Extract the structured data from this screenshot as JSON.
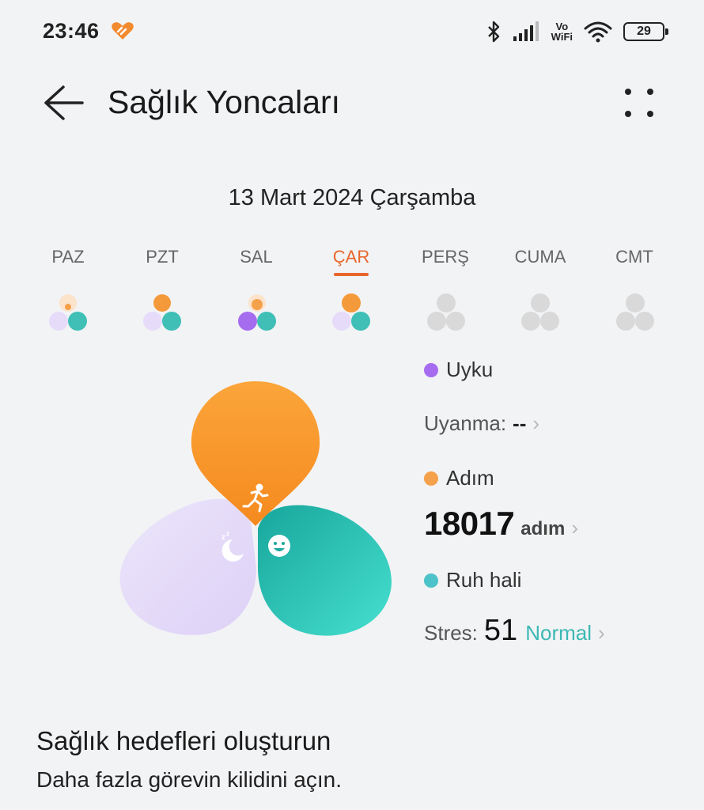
{
  "status_bar": {
    "time": "23:46",
    "vowifi_top": "Vo",
    "vowifi_bottom": "WiFi",
    "battery": "29",
    "icons": [
      "health-app-icon",
      "bluetooth-icon",
      "signal-icon",
      "vowifi-icon",
      "wifi-icon",
      "battery-icon"
    ]
  },
  "header": {
    "title": "Sağlık Yoncaları",
    "back_icon": "arrow-left-icon",
    "more_icon": "more-dots-icon"
  },
  "date": "13 Mart 2024 Çarşamba",
  "days": [
    {
      "label": "PAZ",
      "state": "partial"
    },
    {
      "label": "PZT",
      "state": "partial"
    },
    {
      "label": "SAL",
      "state": "partial"
    },
    {
      "label": "ÇAR",
      "state": "active"
    },
    {
      "label": "PERŞ",
      "state": "empty"
    },
    {
      "label": "CUMA",
      "state": "empty"
    },
    {
      "label": "CMT",
      "state": "empty"
    }
  ],
  "colors": {
    "accent": "#e8662b",
    "sleep": "#a66cf0",
    "steps": "#f5a04a",
    "mood": "#4cc3c8",
    "stress_normal": "#3cb8b4"
  },
  "metrics": {
    "sleep": {
      "label": "Uyku",
      "sub_label": "Uyanma:",
      "value": "--"
    },
    "steps": {
      "label": "Adım",
      "value": "18017",
      "unit": "adım"
    },
    "mood": {
      "label": "Ruh hali",
      "sub_label": "Stres:",
      "value": "51",
      "status": "Normal"
    }
  },
  "clover_icons": [
    "running-person-icon",
    "moon-sleep-icon",
    "smiley-face-icon"
  ],
  "goals": {
    "title": "Sağlık hedefleri oluşturun",
    "subtitle": "Daha fazla görevin kilidini açın."
  }
}
